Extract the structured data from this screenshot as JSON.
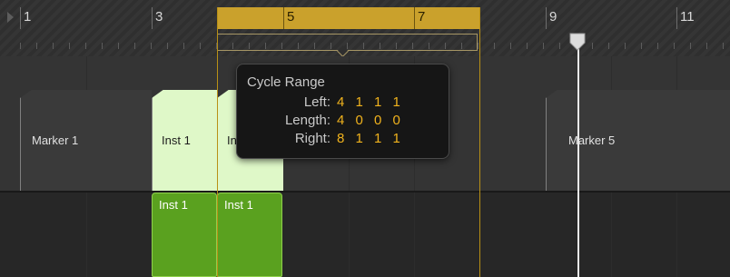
{
  "ruler": {
    "bar_numbers": [
      "1",
      "3",
      "5",
      "7",
      "9",
      "11"
    ]
  },
  "tooltip": {
    "title": "Cycle Range",
    "left_label": "Left:",
    "left_value": "4 1 1 1",
    "length_label": "Length:",
    "length_value": "4 0 0 0",
    "right_label": "Right:",
    "right_value": "8 1 1 1"
  },
  "markers": [
    {
      "label": "Marker 1",
      "color": "#3a3a3a",
      "text_color": "#e0e0e0"
    },
    {
      "label": "Inst 1",
      "color": "#dff8c8",
      "text_color": "#1d1d1d"
    },
    {
      "label": "Inst 1",
      "color": "#dff8c8",
      "text_color": "#1d1d1d"
    },
    {
      "label": "Marker 5",
      "color": "#3a3a3a",
      "text_color": "#e0e0e0"
    }
  ],
  "regions": [
    {
      "label": "Inst 1",
      "color": "#5aa11f"
    },
    {
      "label": "Inst 1",
      "color": "#5aa11f"
    }
  ],
  "colors": {
    "cycle": "#caa12c",
    "cycle_value": "#f0b21d",
    "playhead": "#e9e9e9"
  }
}
